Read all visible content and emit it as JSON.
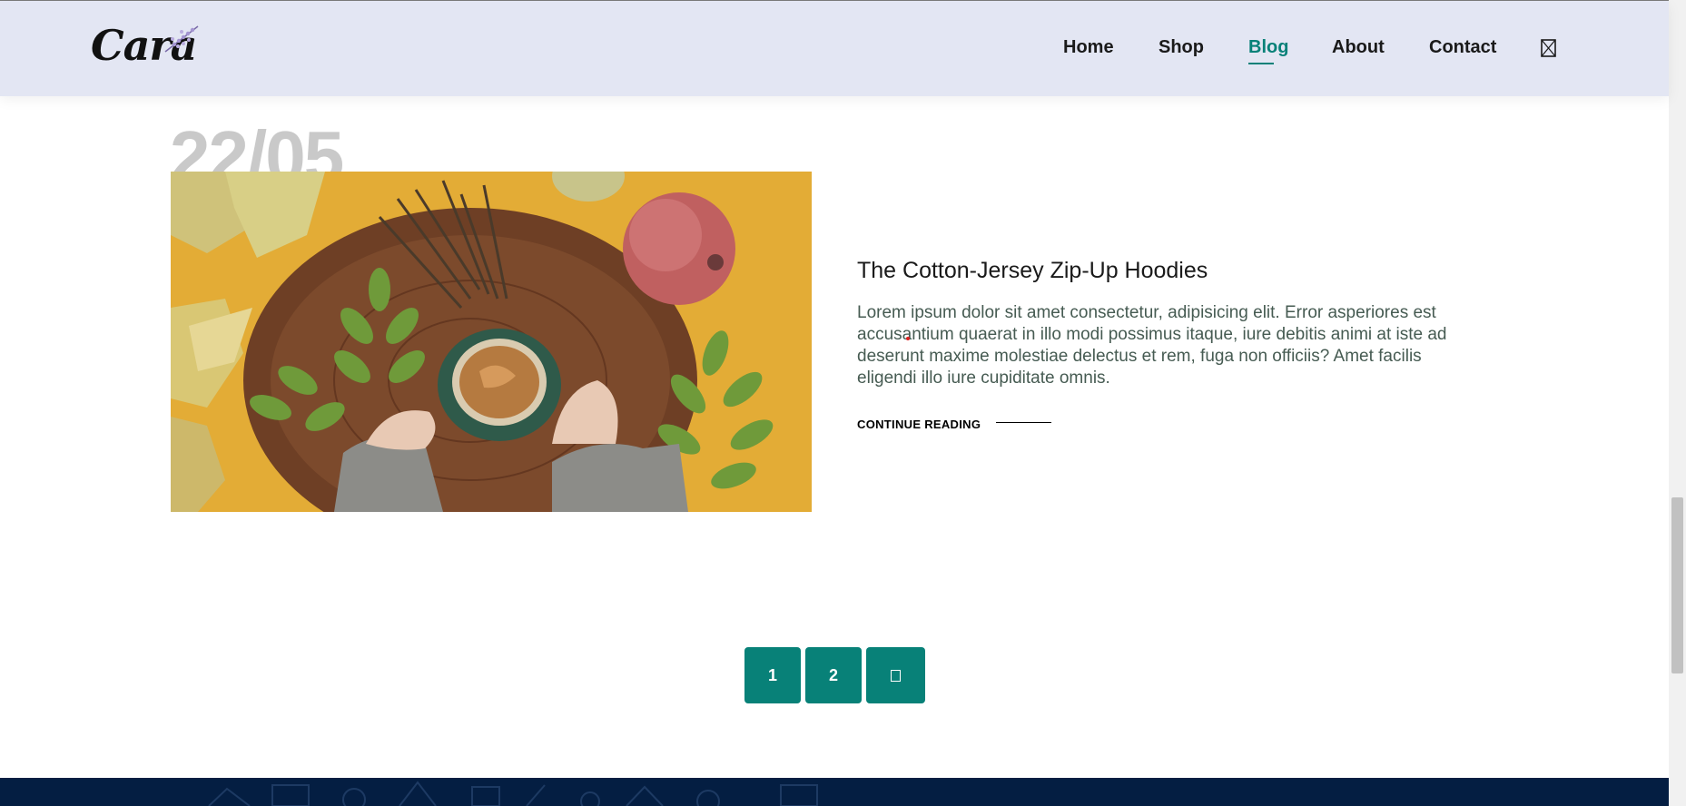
{
  "header": {
    "logo_text": "Cara",
    "nav": [
      {
        "label": "Home"
      },
      {
        "label": "Shop"
      },
      {
        "label": "Blog",
        "active": true
      },
      {
        "label": "About"
      },
      {
        "label": "Contact"
      }
    ],
    "cart_icon": "shopping-bag-icon"
  },
  "post": {
    "date": "22/05",
    "title": "The Cotton-Jersey Zip-Up Hoodies",
    "text": "Lorem ipsum dolor sit amet consectetur, adipisicing elit. Error asperiores est accusantium quaerat in illo modi possimus itaque, iure debitis animi at iste ad deserunt maxime molestiae delectus et rem, fuga non officiis? Amet facilis eligendi illo iure cupiditate omnis.",
    "read_more": "CONTINUE READING"
  },
  "pagination": {
    "pages": [
      "1",
      "2"
    ],
    "next_icon": "arrow-right-icon"
  },
  "colors": {
    "accent": "#088178",
    "header_bg": "#e3e6f3",
    "footer_bg": "#041e42",
    "date_ghost": "#c9c9c9"
  }
}
